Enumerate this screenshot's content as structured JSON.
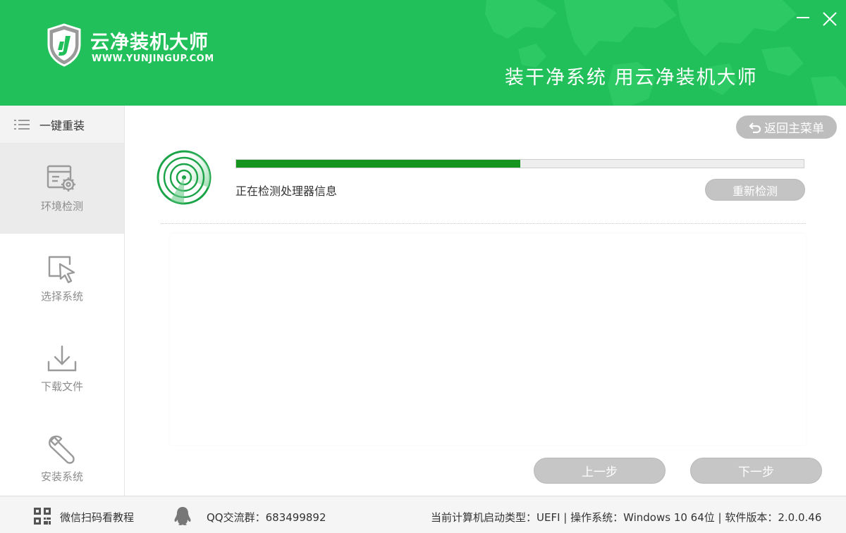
{
  "header": {
    "app_name": "云净装机大师",
    "app_url": "WWW.YUNJINGUP.COM",
    "slogan": "装干净系统 用云净装机大师",
    "logo_icon": "shield-logo-icon",
    "brand_color": "#22c05a"
  },
  "sidebar": {
    "title": "一键重装",
    "items": [
      {
        "label": "环境检测",
        "icon": "environment-check-icon",
        "active": true
      },
      {
        "label": "选择系统",
        "icon": "cursor-select-icon",
        "active": false
      },
      {
        "label": "下载文件",
        "icon": "download-icon",
        "active": false
      },
      {
        "label": "安装系统",
        "icon": "wrench-icon",
        "active": false
      }
    ]
  },
  "main": {
    "back_label": "返回主菜单",
    "progress_fraction": 0.5,
    "status": "正在检测处理器信息",
    "redetect_label": "重新检测",
    "prev_label": "上一步",
    "next_label": "下一步",
    "progress_color": "#15951f"
  },
  "footer": {
    "wechat_label": "微信扫码看教程",
    "qq_label": "QQ交流群：683499892",
    "system_info": "当前计算机启动类型：UEFI | 操作系统：Windows 10 64位 | 软件版本：2.0.0.46"
  }
}
